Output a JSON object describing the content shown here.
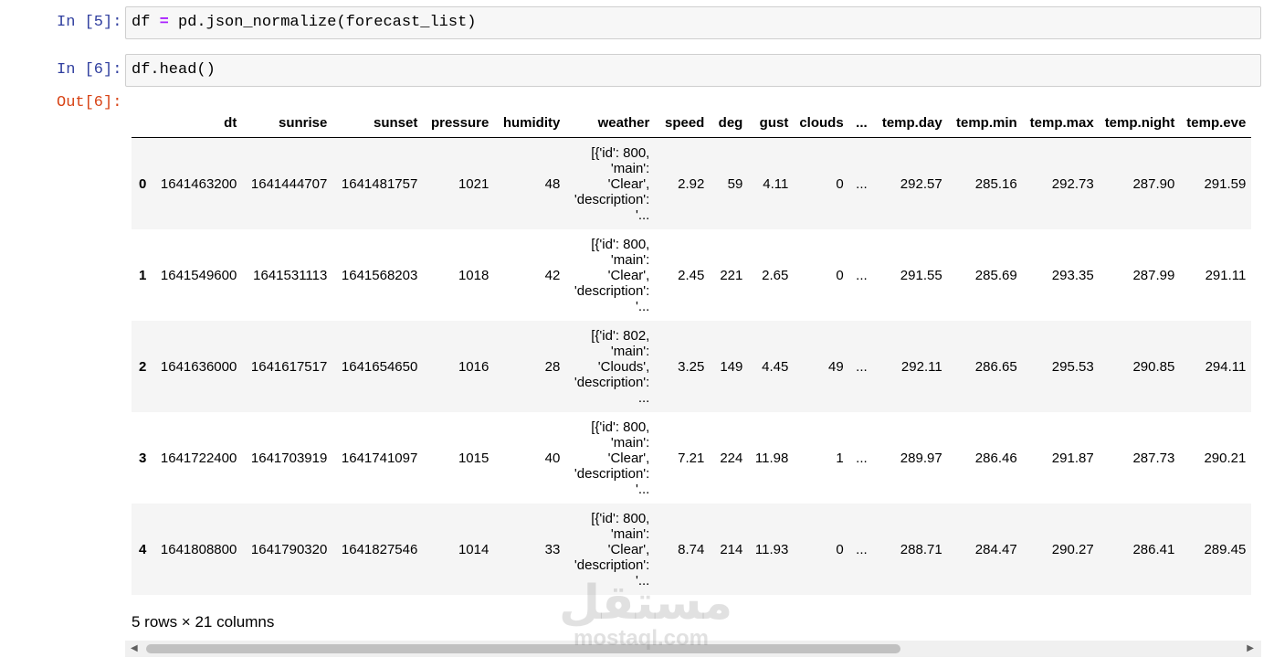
{
  "cells": [
    {
      "prompt": "In [5]:",
      "code_var": "df",
      "code_op": "=",
      "code_rest": "pd.json_normalize(forecast_list)"
    },
    {
      "prompt": "In [6]:",
      "code": "df.head()"
    }
  ],
  "output": {
    "prompt": "Out[6]:",
    "columns": [
      "",
      "dt",
      "sunrise",
      "sunset",
      "pressure",
      "humidity",
      "weather",
      "speed",
      "deg",
      "gust",
      "clouds",
      "...",
      "temp.day",
      "temp.min",
      "temp.max",
      "temp.night",
      "temp.eve"
    ],
    "rows": [
      [
        "0",
        "1641463200",
        "1641444707",
        "1641481757",
        "1021",
        "48",
        "[{'id': 800,\n'main':\n'Clear',\n'description':\n'...",
        "2.92",
        "59",
        "4.11",
        "0",
        "...",
        "292.57",
        "285.16",
        "292.73",
        "287.90",
        "291.59"
      ],
      [
        "1",
        "1641549600",
        "1641531113",
        "1641568203",
        "1018",
        "42",
        "[{'id': 800,\n'main':\n'Clear',\n'description':\n'...",
        "2.45",
        "221",
        "2.65",
        "0",
        "...",
        "291.55",
        "285.69",
        "293.35",
        "287.99",
        "291.11"
      ],
      [
        "2",
        "1641636000",
        "1641617517",
        "1641654650",
        "1016",
        "28",
        "[{'id': 802,\n'main':\n'Clouds',\n'description':\n...",
        "3.25",
        "149",
        "4.45",
        "49",
        "...",
        "292.11",
        "286.65",
        "295.53",
        "290.85",
        "294.11"
      ],
      [
        "3",
        "1641722400",
        "1641703919",
        "1641741097",
        "1015",
        "40",
        "[{'id': 800,\n'main':\n'Clear',\n'description':\n'...",
        "7.21",
        "224",
        "11.98",
        "1",
        "...",
        "289.97",
        "286.46",
        "291.87",
        "287.73",
        "290.21"
      ],
      [
        "4",
        "1641808800",
        "1641790320",
        "1641827546",
        "1014",
        "33",
        "[{'id': 800,\n'main':\n'Clear',\n'description':\n'...",
        "8.74",
        "214",
        "11.93",
        "0",
        "...",
        "288.71",
        "284.47",
        "290.27",
        "286.41",
        "289.45"
      ]
    ],
    "shape_text": "5 rows × 21 columns"
  },
  "scrollbar": {
    "left_arrow": "◀",
    "right_arrow": "▶"
  },
  "watermark": {
    "arabic": "مستقل",
    "latin": "mostaql.com"
  }
}
